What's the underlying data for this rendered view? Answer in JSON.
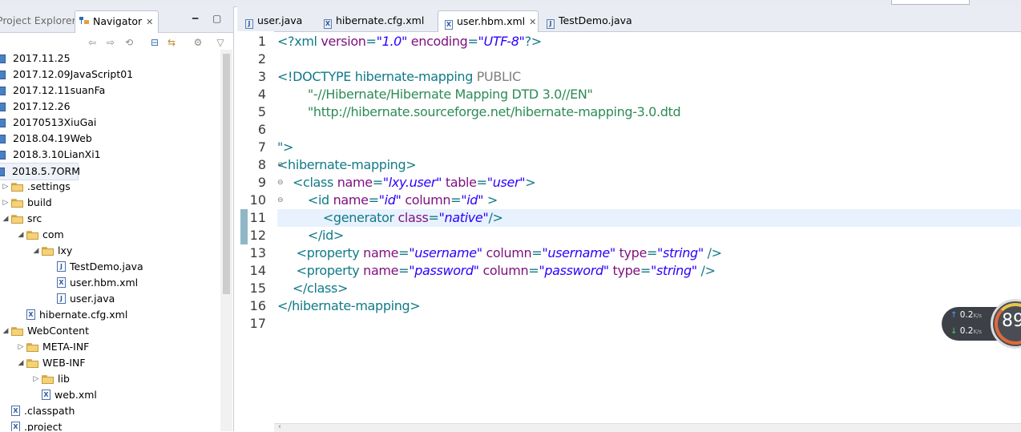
{
  "left_panel": {
    "tab_inactive": "Project Explorer",
    "tab_active": "Navigator",
    "tree": [
      {
        "label": "2017.11.25",
        "depth": 0,
        "kind": "project",
        "expand": ""
      },
      {
        "label": "2017.12.09JavaScript01",
        "depth": 0,
        "kind": "project",
        "expand": ""
      },
      {
        "label": "2017.12.11suanFa",
        "depth": 0,
        "kind": "project",
        "expand": ""
      },
      {
        "label": "2017.12.26",
        "depth": 0,
        "kind": "project",
        "expand": ""
      },
      {
        "label": "20170513XiuGai",
        "depth": 0,
        "kind": "project",
        "expand": ""
      },
      {
        "label": "2018.04.19Web",
        "depth": 0,
        "kind": "project",
        "expand": ""
      },
      {
        "label": "2018.3.10LianXi1",
        "depth": 0,
        "kind": "project",
        "expand": ""
      },
      {
        "label": "2018.5.7ORM",
        "depth": 0,
        "kind": "project",
        "expand": "",
        "selected": true
      },
      {
        "label": ".settings",
        "depth": 1,
        "kind": "folder",
        "expand": "closed"
      },
      {
        "label": "build",
        "depth": 1,
        "kind": "folder",
        "expand": "closed"
      },
      {
        "label": "src",
        "depth": 1,
        "kind": "folder",
        "expand": "open"
      },
      {
        "label": "com",
        "depth": 2,
        "kind": "folder",
        "expand": "open"
      },
      {
        "label": "lxy",
        "depth": 3,
        "kind": "folder",
        "expand": "open"
      },
      {
        "label": "TestDemo.java",
        "depth": 4,
        "kind": "java",
        "expand": ""
      },
      {
        "label": "user.hbm.xml",
        "depth": 4,
        "kind": "xml",
        "expand": ""
      },
      {
        "label": "user.java",
        "depth": 4,
        "kind": "java",
        "expand": ""
      },
      {
        "label": "hibernate.cfg.xml",
        "depth": 2,
        "kind": "xml",
        "expand": ""
      },
      {
        "label": "WebContent",
        "depth": 1,
        "kind": "folder",
        "expand": "open"
      },
      {
        "label": "META-INF",
        "depth": 2,
        "kind": "folder",
        "expand": "closed"
      },
      {
        "label": "WEB-INF",
        "depth": 2,
        "kind": "folder",
        "expand": "open"
      },
      {
        "label": "lib",
        "depth": 3,
        "kind": "folder",
        "expand": "closed"
      },
      {
        "label": "web.xml",
        "depth": 3,
        "kind": "xml",
        "expand": ""
      },
      {
        "label": ".classpath",
        "depth": 1,
        "kind": "xml",
        "expand": ""
      },
      {
        "label": ".project",
        "depth": 1,
        "kind": "xml",
        "expand": ""
      }
    ]
  },
  "editor": {
    "tabs": [
      {
        "label": "user.java",
        "kind": "java",
        "active": false
      },
      {
        "label": "hibernate.cfg.xml",
        "kind": "xml",
        "active": false
      },
      {
        "label": "user.hbm.xml",
        "kind": "xml",
        "active": true
      },
      {
        "label": "TestDemo.java",
        "kind": "java",
        "active": false
      }
    ],
    "current_line": 11,
    "lines": [
      {
        "n": "1",
        "fold": "",
        "seg": [
          [
            "pi",
            "<?xml "
          ],
          [
            "attr",
            "version"
          ],
          [
            "pi",
            "="
          ],
          [
            "val",
            "\"1.0\""
          ],
          [
            "pi",
            " "
          ],
          [
            "attr",
            "encoding"
          ],
          [
            "pi",
            "="
          ],
          [
            "val",
            "\"UTF-8\""
          ],
          [
            "pi",
            "?>"
          ]
        ]
      },
      {
        "n": "2",
        "fold": "",
        "seg": []
      },
      {
        "n": "3",
        "fold": "",
        "seg": [
          [
            "dt",
            "<!DOCTYPE hibernate-mapping "
          ],
          [
            "dtg",
            "PUBLIC"
          ]
        ]
      },
      {
        "n": "4",
        "fold": "",
        "seg": [
          [
            "str",
            "        \"-//Hibernate/Hibernate Mapping DTD 3.0//EN\""
          ]
        ]
      },
      {
        "n": "5",
        "fold": "",
        "seg": [
          [
            "str",
            "        \"http://hibernate.sourceforge.net/hibernate-mapping-3.0.dtd"
          ]
        ]
      },
      {
        "n": "6",
        "fold": "",
        "seg": []
      },
      {
        "n": "7",
        "fold": "",
        "seg": [
          [
            "dt",
            "\">"
          ]
        ]
      },
      {
        "n": "8",
        "fold": "⊖",
        "seg": [
          [
            "tag",
            "<hibernate-mapping>"
          ]
        ]
      },
      {
        "n": "9",
        "fold": "⊖",
        "seg": [
          [
            "tag",
            "    <class "
          ],
          [
            "attr",
            "name"
          ],
          [
            "tag",
            "="
          ],
          [
            "val",
            "\"lxy.user\""
          ],
          [
            "tag",
            " "
          ],
          [
            "attr",
            "table"
          ],
          [
            "tag",
            "="
          ],
          [
            "val",
            "\"user\""
          ],
          [
            "tag",
            ">"
          ]
        ]
      },
      {
        "n": "10",
        "fold": "⊖",
        "seg": [
          [
            "tag",
            "        <id "
          ],
          [
            "attr",
            "name"
          ],
          [
            "tag",
            "="
          ],
          [
            "val",
            "\"id\""
          ],
          [
            "tag",
            " "
          ],
          [
            "attr",
            "column"
          ],
          [
            "tag",
            "="
          ],
          [
            "val",
            "\"id\""
          ],
          [
            "tag",
            " >"
          ]
        ]
      },
      {
        "n": "11",
        "fold": "",
        "seg": [
          [
            "tag",
            "            <generator "
          ],
          [
            "attr",
            "class"
          ],
          [
            "tag",
            "="
          ],
          [
            "val",
            "\"native\""
          ],
          [
            "tag",
            "/>"
          ]
        ]
      },
      {
        "n": "12",
        "fold": "",
        "seg": [
          [
            "tag",
            "        </id>"
          ]
        ]
      },
      {
        "n": "13",
        "fold": "",
        "seg": [
          [
            "tag",
            "     <property "
          ],
          [
            "attr",
            "name"
          ],
          [
            "tag",
            "="
          ],
          [
            "val",
            "\"username\""
          ],
          [
            "tag",
            " "
          ],
          [
            "attr",
            "column"
          ],
          [
            "tag",
            "="
          ],
          [
            "val",
            "\"username\""
          ],
          [
            "tag",
            " "
          ],
          [
            "attr",
            "type"
          ],
          [
            "tag",
            "="
          ],
          [
            "val",
            "\"string\""
          ],
          [
            "tag",
            " />"
          ]
        ]
      },
      {
        "n": "14",
        "fold": "",
        "seg": [
          [
            "tag",
            "     <property "
          ],
          [
            "attr",
            "name"
          ],
          [
            "tag",
            "="
          ],
          [
            "val",
            "\"password\""
          ],
          [
            "tag",
            " "
          ],
          [
            "attr",
            "column"
          ],
          [
            "tag",
            "="
          ],
          [
            "val",
            "\"password\""
          ],
          [
            "tag",
            " "
          ],
          [
            "attr",
            "type"
          ],
          [
            "tag",
            "="
          ],
          [
            "val",
            "\"string\""
          ],
          [
            "tag",
            " />"
          ]
        ]
      },
      {
        "n": "15",
        "fold": "",
        "seg": [
          [
            "tag",
            "    </class>"
          ]
        ]
      },
      {
        "n": "16",
        "fold": "",
        "seg": [
          [
            "tag",
            "</hibernate-mapping>"
          ]
        ]
      },
      {
        "n": "17",
        "fold": "",
        "seg": []
      }
    ]
  },
  "net_widget": {
    "upload": "0.2",
    "download": "0.2",
    "unit": "K/s",
    "score": "89"
  },
  "colors": {
    "tag": "#117a87",
    "attribute": "#7f0f7f",
    "value": "#2a00ff",
    "doctype_string": "#2e8b57",
    "current_line": "#e8f2fe"
  }
}
